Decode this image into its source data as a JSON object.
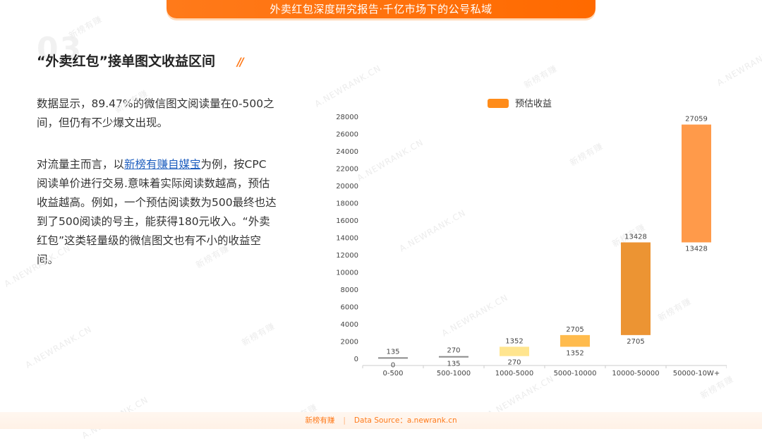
{
  "banner": {
    "title": "外卖红包深度研究报告·千亿市场下的公号私域"
  },
  "section": {
    "number": "03",
    "title": "“外卖红包”接单图文收益区间",
    "title_mark": "//"
  },
  "text": {
    "paragraph1": "数据显示，89.47%的微信图文阅读量在0-500之间，但仍有不少爆文出现。",
    "p2_before": "对流量主而言，以",
    "p2_link": "新榜有赚自媒宝",
    "p2_after": "为例，按CPC阅读单价进行交易.意味着实际阅读数越高，预估收益越高。例如，一个预估阅读数为500最终也达到了500阅读的号主，能获得180元收入。“外卖红包”这类轻量级的微信图文也有不小的收益空间。"
  },
  "watermarks": {
    "a": "A.NEWRANK.CN",
    "b": "新榜有赚"
  },
  "footer": {
    "brand": "新榜有赚",
    "source": "Data Source：a.newrank.cn"
  },
  "colors": {
    "accent": "#ff7a1a",
    "link": "#1f5fbf"
  },
  "chart_data": {
    "type": "bar",
    "subtype": "floating",
    "categories": [
      "0-500",
      "500-1000",
      "1000-5000",
      "5000-10000",
      "10000-50000",
      "50000-10W+"
    ],
    "series": [
      {
        "name": "预估收益",
        "low": [
          0,
          135,
          270,
          1352,
          2705,
          13428
        ],
        "high": [
          135,
          270,
          1352,
          2705,
          13428,
          27059
        ],
        "colors": [
          "#8a8a8a",
          "#8a8a8a",
          "#ffe58f",
          "#ffbb4d",
          "#ec9433",
          "#ff9a4a"
        ]
      }
    ],
    "legend_color": "#ff8c1a",
    "ylim": [
      0,
      28000
    ],
    "yticks": [
      0,
      2000,
      4000,
      6000,
      8000,
      10000,
      12000,
      14000,
      16000,
      18000,
      20000,
      22000,
      24000,
      26000,
      28000
    ],
    "legend_position": "top",
    "grid": false
  }
}
